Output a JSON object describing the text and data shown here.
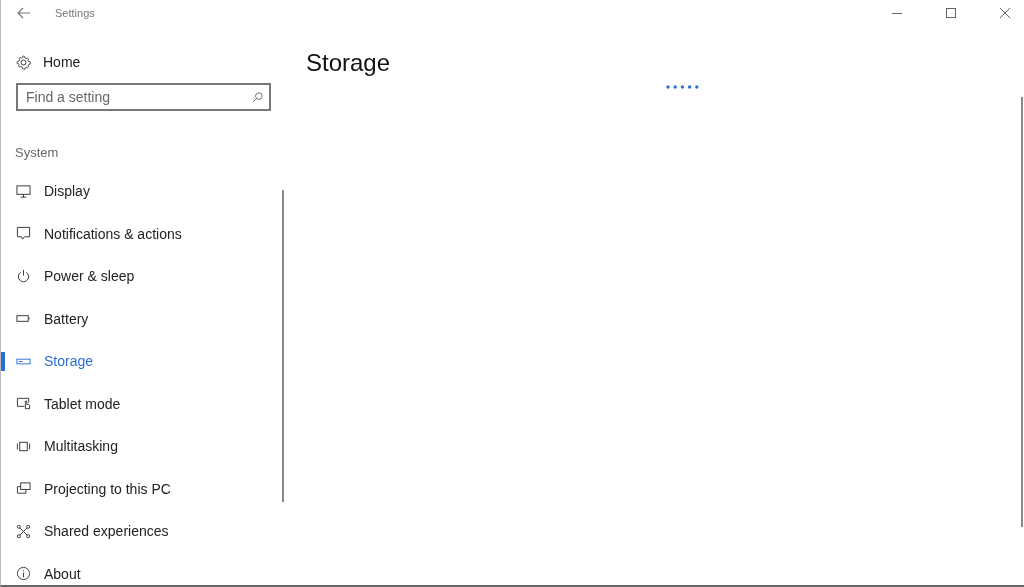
{
  "window": {
    "title": "Settings"
  },
  "sidebar": {
    "home": "Home",
    "search": {
      "placeholder": "Find a setting"
    },
    "section": "System",
    "items": [
      {
        "label": "Display",
        "selected": false
      },
      {
        "label": "Notifications & actions",
        "selected": false
      },
      {
        "label": "Power & sleep",
        "selected": false
      },
      {
        "label": "Battery",
        "selected": false
      },
      {
        "label": "Storage",
        "selected": true
      },
      {
        "label": "Tablet mode",
        "selected": false
      },
      {
        "label": "Multitasking",
        "selected": false
      },
      {
        "label": "Projecting to this PC",
        "selected": false
      },
      {
        "label": "Shared experiences",
        "selected": false
      },
      {
        "label": "About",
        "selected": false
      }
    ]
  },
  "page": {
    "title": "Storage",
    "loading": true
  }
}
